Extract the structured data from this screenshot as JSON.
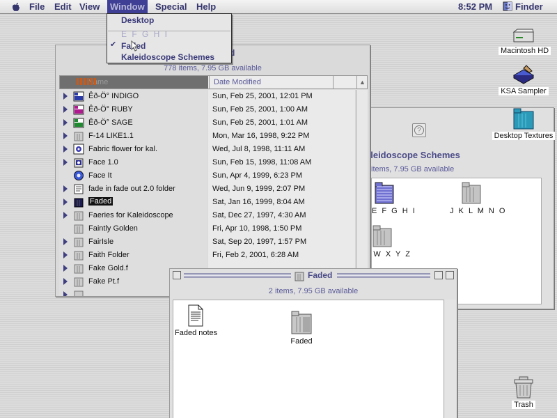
{
  "menubar": {
    "menus": [
      "File",
      "Edit",
      "View",
      "Window",
      "Special",
      "Help"
    ],
    "clock": "8:52 PM",
    "app": "Finder"
  },
  "window_menu": {
    "items": [
      "Desktop",
      "E F G H I",
      "Faded",
      "Kaleidoscope Schemes"
    ],
    "checked": "Faded"
  },
  "list_window": {
    "title": "d",
    "info": "778 items, 7.95 GB available",
    "col_name": "Name",
    "col_date": "Date Modified",
    "rows": [
      {
        "name": "Êð-Ö° INDIGO",
        "date": "Sun, Feb 25, 2001, 12:01 PM",
        "icon": "color-scheme-icon",
        "color": "#2a3aa8"
      },
      {
        "name": "Êð-Ö° RUBY",
        "date": "Sun, Feb 25, 2001, 1:00 AM",
        "icon": "color-scheme-icon",
        "color": "#b01890"
      },
      {
        "name": "Êð-Ö° SAGE",
        "date": "Sun, Feb 25, 2001, 1:01 AM",
        "icon": "color-scheme-icon",
        "color": "#208a30"
      },
      {
        "name": "F-14 LIKE1.1",
        "date": "Mon, Mar 16, 1998, 9:22 PM",
        "icon": "folder-icon"
      },
      {
        "name": "Fabric flower for kal.",
        "date": "Wed, Jul 8, 1998, 11:11 AM",
        "icon": "picture-folder-icon"
      },
      {
        "name": "Face 1.0",
        "date": "Sun, Feb 15, 1998, 11:08 AM",
        "icon": "app-folder-icon"
      },
      {
        "name": "Face It",
        "date": "Sun, Apr 4, 1999, 6:23 PM",
        "icon": "blue-globe-icon"
      },
      {
        "name": "fade in fade out 2.0 folder",
        "date": "Wed, Jun 9, 1999, 2:07 PM",
        "icon": "document-folder-icon"
      },
      {
        "name": "Faded",
        "date": "Sat, Jan 16, 1999, 8:04 AM",
        "icon": "dark-folder-icon",
        "selected": true
      },
      {
        "name": "Faeries for Kaleidoscope",
        "date": "Sat, Dec 27, 1997, 4:30 AM",
        "icon": "folder-icon"
      },
      {
        "name": "Faintly Golden",
        "date": "Fri, Apr 10, 1998, 1:50 PM",
        "icon": "folder-icon",
        "leaf": true
      },
      {
        "name": "FairIsle",
        "date": "Sat, Sep 20, 1997, 1:57 PM",
        "icon": "folder-icon"
      },
      {
        "name": "Faith Folder",
        "date": "Fri, Feb 2, 2001, 6:28 AM",
        "icon": "folder-icon"
      },
      {
        "name": "Fake Gold.f",
        "date": "",
        "icon": "folder-icon"
      },
      {
        "name": "Fake Pt.f",
        "date": "",
        "icon": "folder-icon"
      },
      {
        "name": "",
        "date": "",
        "icon": "folder-icon"
      }
    ],
    "stray": "1"
  },
  "kal_window": {
    "title": "aleidoscope Schemes",
    "info": "items, 7.95 GB available",
    "folders": [
      "E F G H I",
      "J K L M N O",
      "V W X Y Z"
    ]
  },
  "faded_window": {
    "title": "Faded",
    "info": "2 items, 7.95 GB available",
    "items": [
      "Faded notes",
      "Faded"
    ]
  },
  "desktop": {
    "icons": [
      "Macintosh HD",
      "KSA Sampler",
      "Desktop Textures",
      "Trash"
    ]
  }
}
